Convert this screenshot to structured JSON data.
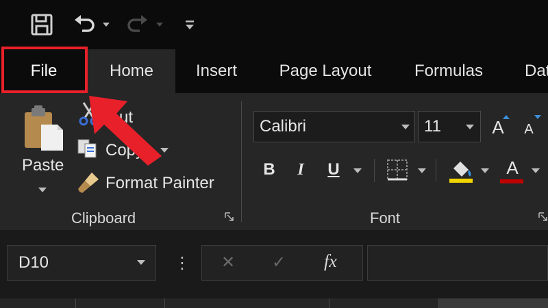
{
  "quick_access": {
    "icons": [
      "save-icon",
      "undo-icon",
      "redo-icon",
      "customize-toolbar-icon"
    ]
  },
  "tabs": [
    {
      "label": "File"
    },
    {
      "label": "Home"
    },
    {
      "label": "Insert"
    },
    {
      "label": "Page Layout"
    },
    {
      "label": "Formulas"
    },
    {
      "label": "Dat"
    }
  ],
  "clipboard": {
    "paste_label": "Paste",
    "cut_label": "ut",
    "copy_label": "Copy",
    "format_painter_label": "Format Painter",
    "group_label": "Clipboard"
  },
  "font": {
    "font_name": "Calibri",
    "font_size": "11",
    "grow_label": "A",
    "shrink_label": "A",
    "bold_label": "B",
    "italic_label": "I",
    "underline_label": "U",
    "font_color_label": "A",
    "group_label": "Font"
  },
  "formula_bar": {
    "name_box": "D10",
    "more_label": "⋮",
    "cancel_label": "✕",
    "enter_label": "✓",
    "fx_label": "fx"
  },
  "colors": {
    "highlight_border": "#e8202a",
    "arrow": "#e8202a",
    "fill_color_swatch": "#f2d500",
    "font_color_swatch": "#c00000",
    "ribbon_bg": "#262626",
    "window_bg": "#0b0b0b"
  }
}
